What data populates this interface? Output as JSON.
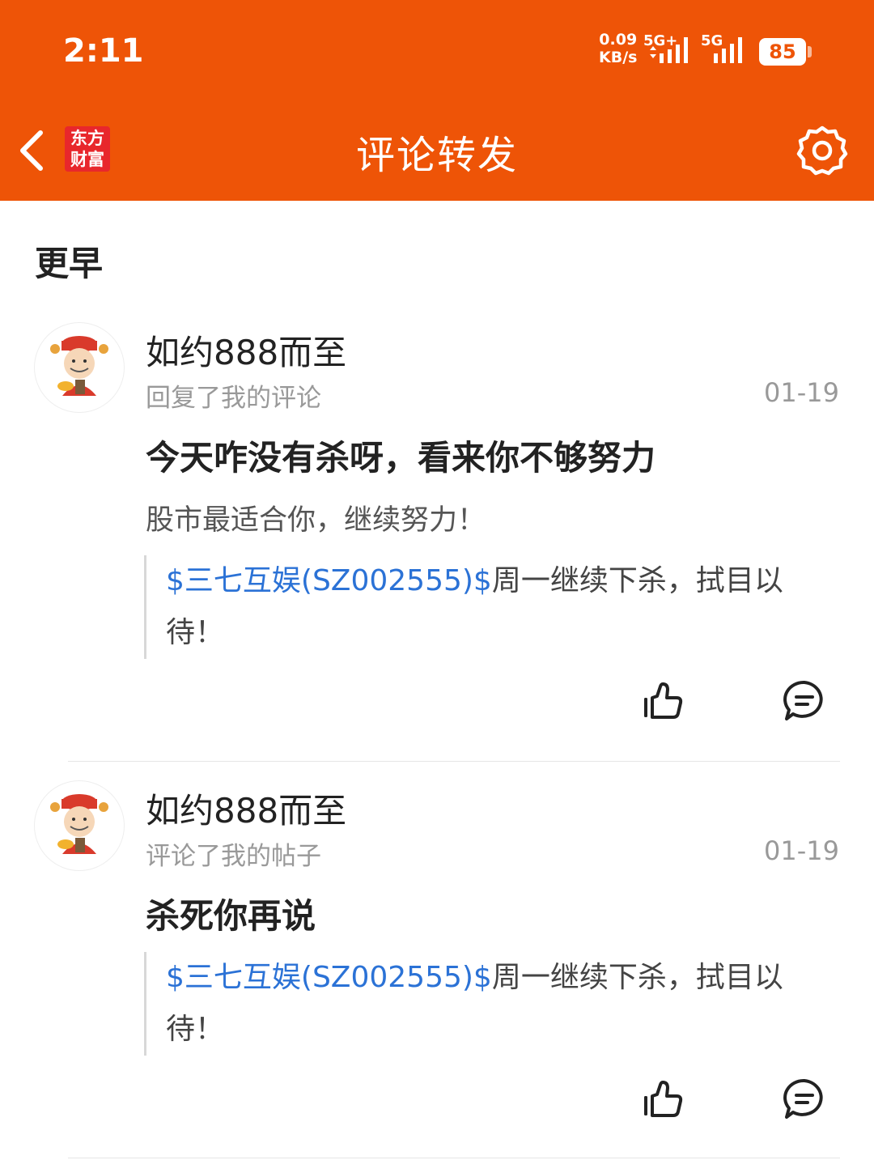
{
  "status_bar": {
    "time": "2:11",
    "net_speed_value": "0.09",
    "net_speed_unit": "KB/s",
    "signal1_label": "5G+",
    "signal2_label": "5G",
    "battery": "85"
  },
  "header": {
    "logo_line1": "东方",
    "logo_line2": "财富",
    "title": "评论转发"
  },
  "colors": {
    "header_bg": "#EE5407",
    "link_blue": "#2B72D6"
  },
  "section_label": "更早",
  "items": [
    {
      "username": "如约888而至",
      "action": "回复了我的评论",
      "date": "01-19",
      "comment": "今天咋没有杀呀，看来你不够努力",
      "subtext": "股市最适合你，继续努力！",
      "quote_stock": "$三七互娱(SZ002555)$",
      "quote_text": "周一继续下杀，拭目以待！"
    },
    {
      "username": "如约888而至",
      "action": "评论了我的帖子",
      "date": "01-19",
      "comment": "杀死你再说",
      "quote_stock": "$三七互娱(SZ002555)$",
      "quote_text": "周一继续下杀，拭目以待！"
    }
  ]
}
